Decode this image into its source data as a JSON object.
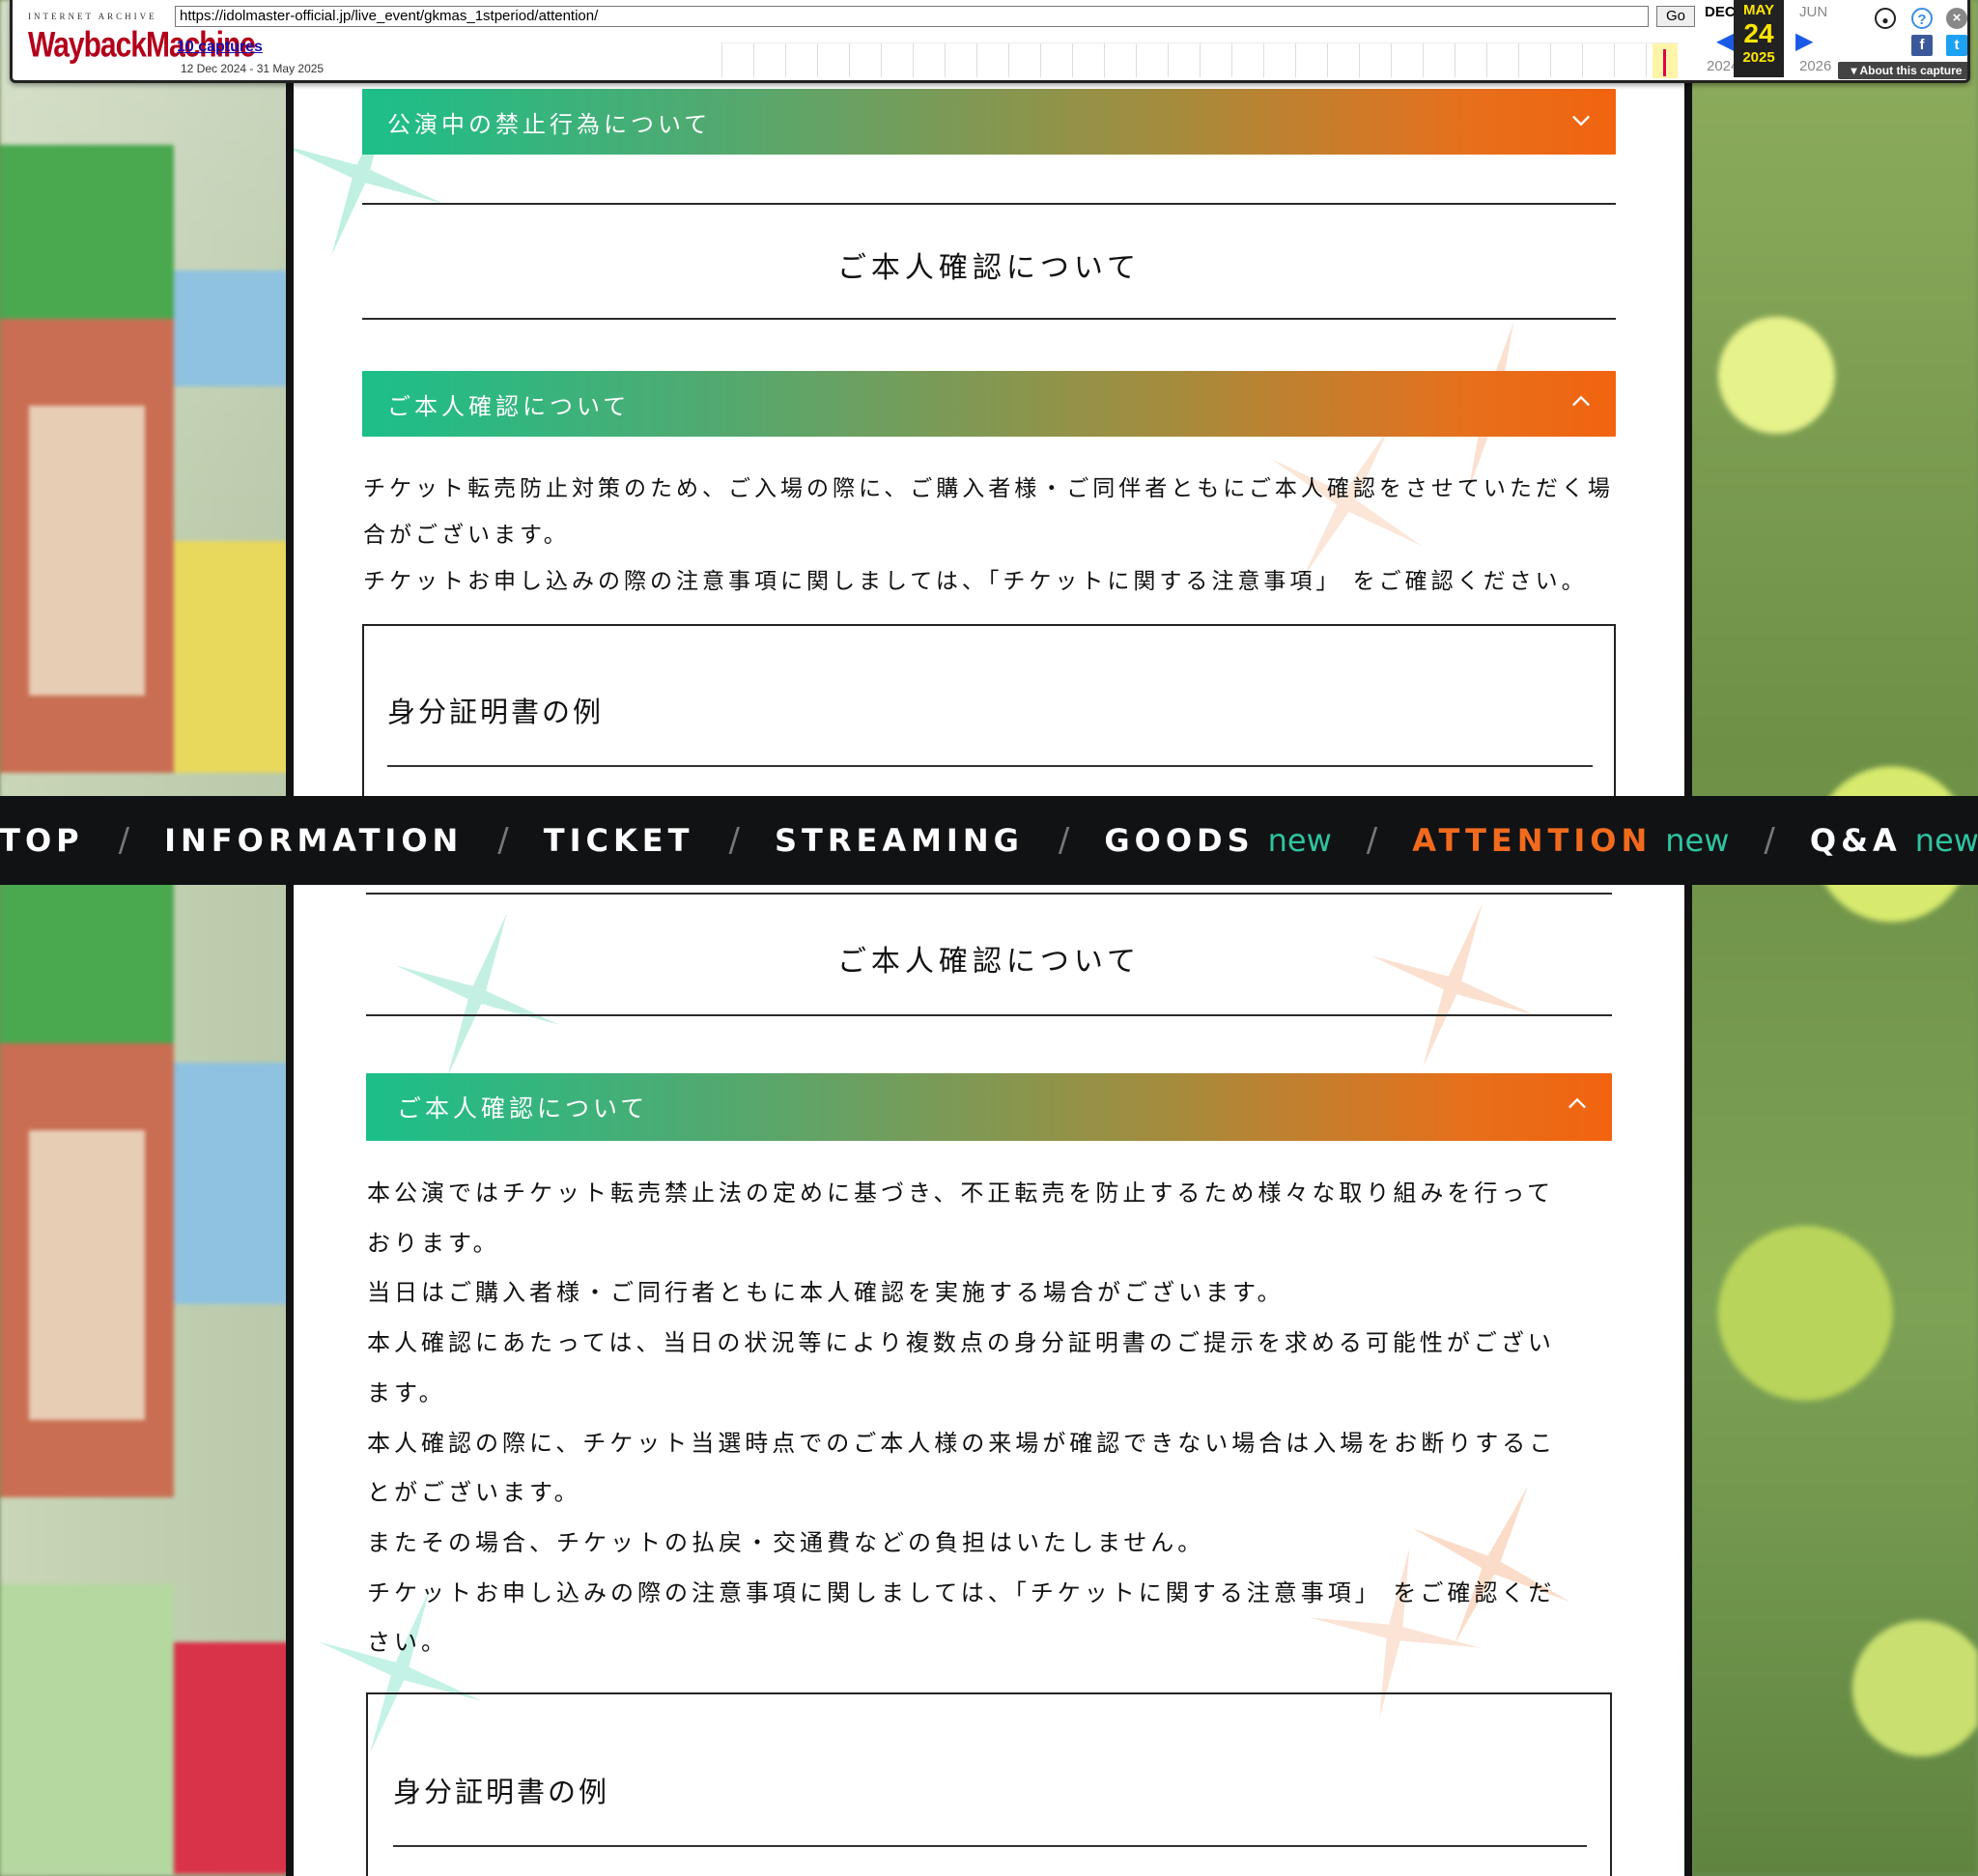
{
  "wayback": {
    "label_top": "INTERNET ARCHIVE",
    "logo_text": "WaybackMachine",
    "url": "https://idolmaster-official.jp/live_event/gkmas_1stperiod/attention/",
    "go_label": "Go",
    "captures": "10 captures",
    "range": "12 Dec 2024 - 31 May 2025",
    "prev_month": "DEC",
    "prev_year": "2024",
    "cur_month": "MAY",
    "cur_day": "24",
    "cur_year": "2025",
    "next_month": "JUN",
    "next_year": "2026",
    "about": "About this capture"
  },
  "nav": {
    "items": [
      {
        "label": "TOP"
      },
      {
        "label": "INFORMATION"
      },
      {
        "label": "TICKET"
      },
      {
        "label": "STREAMING"
      },
      {
        "label": "GOODS",
        "badge": "new"
      },
      {
        "label": "ATTENTION",
        "badge": "new",
        "active": true
      },
      {
        "label": "Q&A",
        "badge": "new"
      }
    ],
    "separator": "/"
  },
  "top_half": {
    "accordion_prohibited": "公演中の禁止行為について",
    "section_title": "ご本人確認について",
    "accordion_identity": "ご本人確認について",
    "body": [
      "チケット転売防止対策のため、ご入場の際に、ご購入者様・ご同伴者ともにご本人確認をさせていただく場",
      "合がございます。",
      "チケットお申し込みの際の注意事項に関しましては、「チケットに関する注意事項」 をご確認ください。"
    ],
    "id_box_title": "身分証明書の例"
  },
  "bottom_half": {
    "section_title": "ご本人確認について",
    "accordion_identity": "ご本人確認について",
    "body": [
      "本公演ではチケット転売禁止法の定めに基づき、不正転売を防止するため様々な取り組みを行って",
      "おります。",
      "当日はご購入者様・ご同行者ともに本人確認を実施する場合がございます。",
      "本人確認にあたっては、当日の状況等により複数点の身分証明書のご提示を求める可能性がござい",
      "ます。",
      "本人確認の際に、チケット当選時点でのご本人様の来場が確認できない場合は入場をお断りするこ",
      "とがございます。",
      "またその場合、チケットの払戻・交通費などの負担はいたしません。",
      "チケットお申し込みの際の注意事項に関しましては、「チケットに関する注意事項」 をご確認くだ",
      "さい。"
    ],
    "id_box_title": "身分証明書の例"
  },
  "colors": {
    "gradient_start": "#1cbf8a",
    "gradient_end": "#f2630f",
    "nav_bg": "#111214",
    "nav_active": "#f26b1d",
    "nav_new": "#2ec4a0"
  },
  "icons": [
    "chevron-down-icon",
    "chevron-up-icon",
    "user-icon",
    "help-icon",
    "close-icon",
    "facebook-icon",
    "twitter-icon",
    "arrow-left-icon",
    "arrow-right-icon"
  ]
}
